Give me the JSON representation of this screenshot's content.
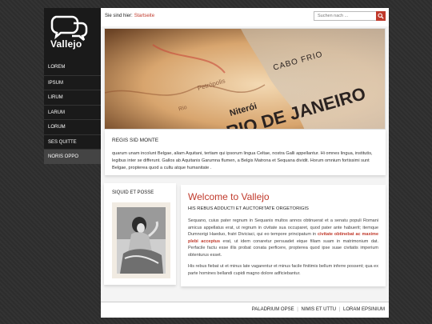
{
  "logo": {
    "text": "Vallejo",
    "icon": "speech-bubbles-icon"
  },
  "nav": [
    "LOREM",
    "IPSUM",
    "LIRUM",
    "LARUM",
    "LORUM",
    "SES QUITTE",
    "NORIS OPPO"
  ],
  "breadcrumb": {
    "prefix": "Sie sind hier:",
    "link": "Startseite"
  },
  "search": {
    "placeholder": "Suchen nach ...",
    "icon": "search-icon"
  },
  "banner": {
    "text_line1": "RIO DE JANEIRO",
    "text_small1": "CABO FRIO",
    "text_small2": "Niterói",
    "text_small3": "Petrópolis",
    "text_small4": "Rio"
  },
  "box1": {
    "title": "REGIS SID MONTE",
    "text": "quarum unam incolunt Belgae, aliam Aquitani, tertiam qui ipsorum lingua Celtae, nostra Galli appellantur. Hi omnes lingua, institutis, legibus inter se differunt. Gallos ab Aquitanis Garumna flumen, a Belgis Matrona et Sequana dividit. Horum omnium fortissimi sunt Belgae, propterea quod a cultu atque humanitate ."
  },
  "box2": {
    "title": "SIQUID ET POSSE"
  },
  "welcome": {
    "title": "Welcome to Vallejo",
    "subtitle": "HIS REBUS ADDUCTI ET AUCTORITATE ORGETORIGIS",
    "p1_a": "Sequano, cuius pater regnum in Sequanis multos annos obtinuerat et a senatu populi Romani amicus appellatus erat, ut regnum in civitate sua occuparet, quod pater ante habuerit; itemque Dumnorigi Haeduo, fratri Diviciaci, qui eo tempore principatum in ",
    "p1_link": "civitate obtinebat ac maxime plebi acceptus",
    "p1_b": " erat, ut idem conaretur persuadet eique filiam suam in matrimonium dat. Perfacile factu esse illis probat conata perficere, propterea quod ipse suae civitatis imperium obtenturus esset.",
    "p2": "His rebus fiebat ut et minus late vagarentur et minus facile finitimis bellum inferre possent; qua ex parte homines bellandi cupidi magno dolore adficiebantur."
  },
  "footer": {
    "link1": "PALADRIUM OPSE",
    "sep": "|",
    "link2": "NIMIS ET UTTU",
    "link3": "LORAM EPSINIUM"
  },
  "colors": {
    "accent": "#c0392b",
    "sidebar": "#1a1a1a",
    "background": "#2e2e2e"
  }
}
